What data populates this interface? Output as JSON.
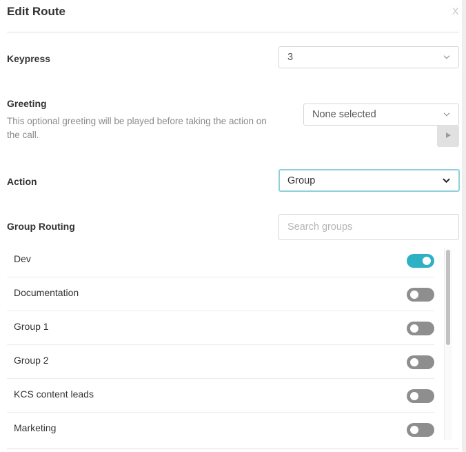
{
  "dialog": {
    "title": "Edit Route",
    "close_label": "X"
  },
  "keypress": {
    "label": "Keypress",
    "value": "3"
  },
  "greeting": {
    "label": "Greeting",
    "help": "This optional greeting will be played before taking the action on the call.",
    "value": "None selected",
    "play_icon": "play-icon"
  },
  "action": {
    "label": "Action",
    "value": "Group"
  },
  "group_routing": {
    "label": "Group Routing",
    "search_placeholder": "Search groups",
    "groups": [
      {
        "name": "Dev",
        "enabled": true
      },
      {
        "name": "Documentation",
        "enabled": false
      },
      {
        "name": "Group 1",
        "enabled": false
      },
      {
        "name": "Group 2",
        "enabled": false
      },
      {
        "name": "KCS content leads",
        "enabled": false
      },
      {
        "name": "Marketing",
        "enabled": false
      }
    ]
  },
  "colors": {
    "toggle_on": "#2eb1c4",
    "toggle_off": "#8e8e8e",
    "focus_border": "#8fd0db"
  }
}
